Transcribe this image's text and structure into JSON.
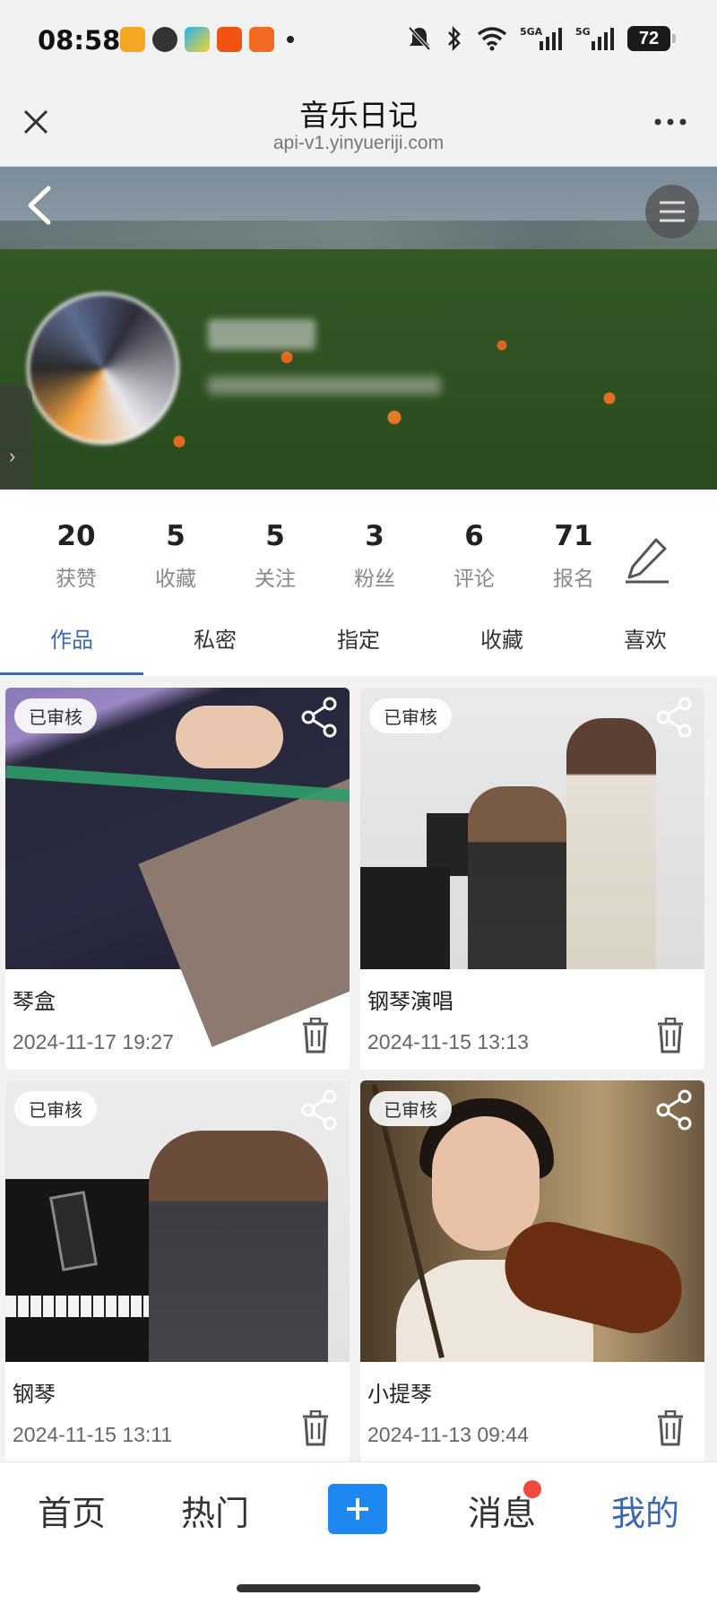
{
  "status_bar": {
    "time": "08:58",
    "battery": "72",
    "network_1": "5GA",
    "network_2": "5G"
  },
  "titlebar": {
    "title": "音乐日记",
    "url": "api-v1.yinyueriji.com"
  },
  "stats": [
    {
      "value": "20",
      "label": "获赞"
    },
    {
      "value": "5",
      "label": "收藏"
    },
    {
      "value": "5",
      "label": "关注"
    },
    {
      "value": "3",
      "label": "粉丝"
    },
    {
      "value": "6",
      "label": "评论"
    },
    {
      "value": "71",
      "label": "报名"
    }
  ],
  "tabs": [
    {
      "label": "作品",
      "active": true
    },
    {
      "label": "私密"
    },
    {
      "label": "指定"
    },
    {
      "label": "收藏"
    },
    {
      "label": "喜欢"
    }
  ],
  "works": [
    {
      "status": "已审核",
      "title": "琴盒",
      "date": "2024-11-17 19:27"
    },
    {
      "status": "已审核",
      "title": "钢琴演唱",
      "date": "2024-11-15 13:13"
    },
    {
      "status": "已审核",
      "title": "钢琴",
      "date": "2024-11-15 13:11"
    },
    {
      "status": "已审核",
      "title": "小提琴",
      "date": "2024-11-13 09:44"
    }
  ],
  "bottom_nav": [
    {
      "label": "首页"
    },
    {
      "label": "热门"
    },
    {
      "label": "消息",
      "has_dot": true
    },
    {
      "label": "我的",
      "active": true
    }
  ],
  "colors": {
    "accent": "#3b68b5",
    "plus_button": "#1e87f0",
    "badge_dot": "#f04a3a"
  }
}
